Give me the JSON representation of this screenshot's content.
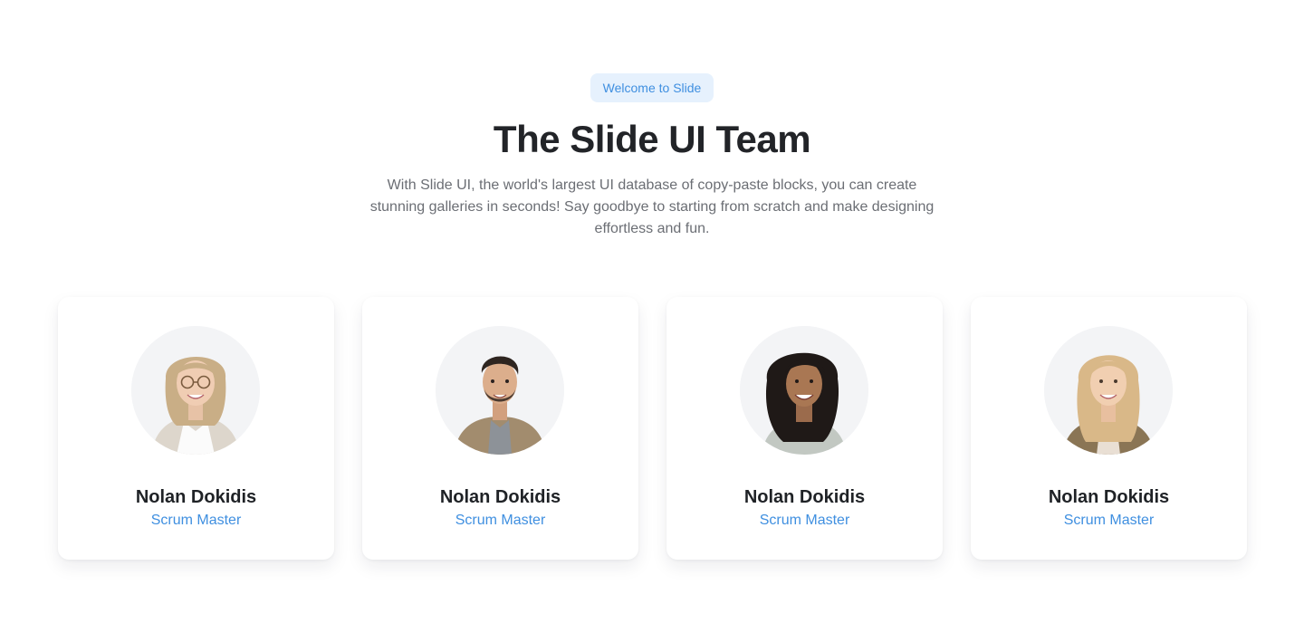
{
  "hero": {
    "badge": "Welcome to Slide",
    "title": "The Slide UI Team",
    "subtitle": "With Slide UI, the world's largest UI database of copy-paste blocks, you can create stunning galleries in seconds! Say goodbye to starting from scratch and make designing effortless and fun."
  },
  "team": [
    {
      "name": "Nolan Dokidis",
      "role": "Scrum Master",
      "avatar_icon": "woman-glasses-avatar"
    },
    {
      "name": "Nolan Dokidis",
      "role": "Scrum Master",
      "avatar_icon": "man-jacket-avatar"
    },
    {
      "name": "Nolan Dokidis",
      "role": "Scrum Master",
      "avatar_icon": "woman-curly-hair-avatar"
    },
    {
      "name": "Nolan Dokidis",
      "role": "Scrum Master",
      "avatar_icon": "woman-blonde-avatar"
    }
  ],
  "colors": {
    "accent": "#3f8fe0",
    "badge_bg": "#e6f1fd",
    "heading": "#222428",
    "body_text": "#6b6e74"
  }
}
